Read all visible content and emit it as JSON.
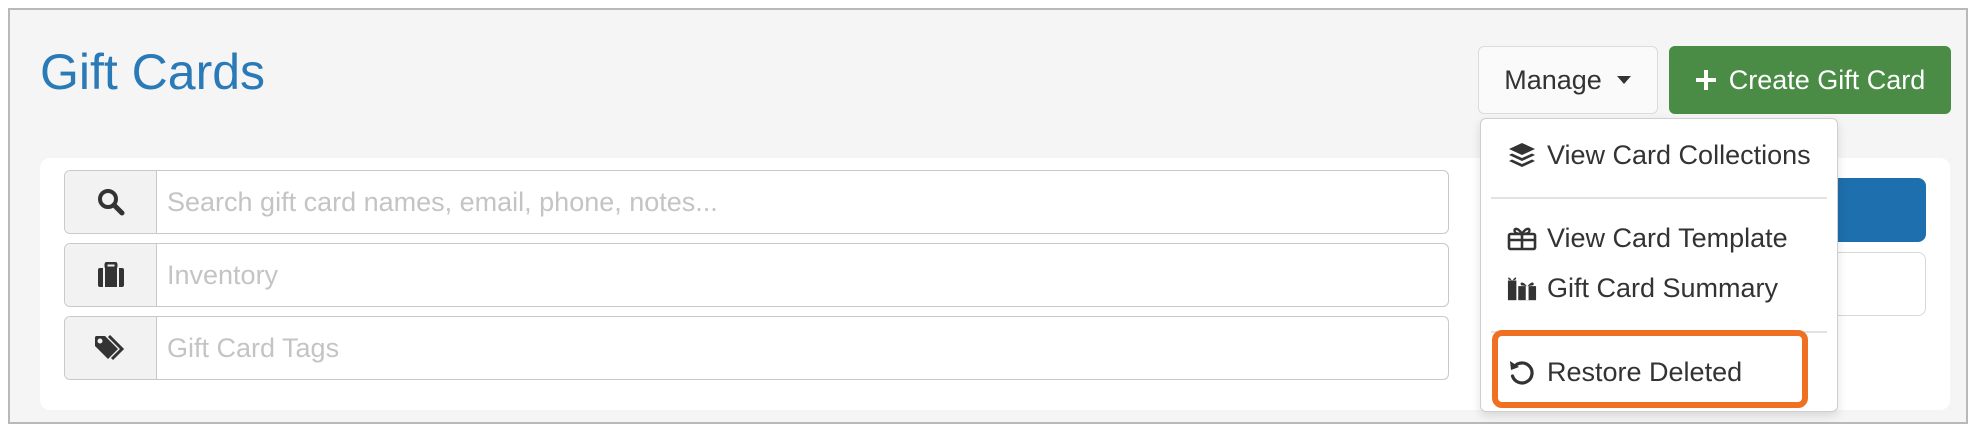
{
  "header": {
    "title": "Gift Cards",
    "manage_label": "Manage",
    "create_label": "Create Gift Card"
  },
  "search": {
    "search_placeholder": "Search gift card names, email, phone, notes...",
    "inventory_placeholder": "Inventory",
    "tags_placeholder": "Gift Card Tags"
  },
  "menu": {
    "items": [
      {
        "label": "View Card Collections",
        "icon": "layers-icon"
      },
      {
        "label": "View Card Template",
        "icon": "gift-icon"
      },
      {
        "label": "Gift Card Summary",
        "icon": "gifts-icon"
      },
      {
        "label": "Restore Deleted",
        "icon": "undo-icon"
      }
    ]
  },
  "colors": {
    "title": "#2a7ab8",
    "create_button": "#4a8b46",
    "primary_button": "#1e6fad",
    "highlight": "#ef7023"
  }
}
